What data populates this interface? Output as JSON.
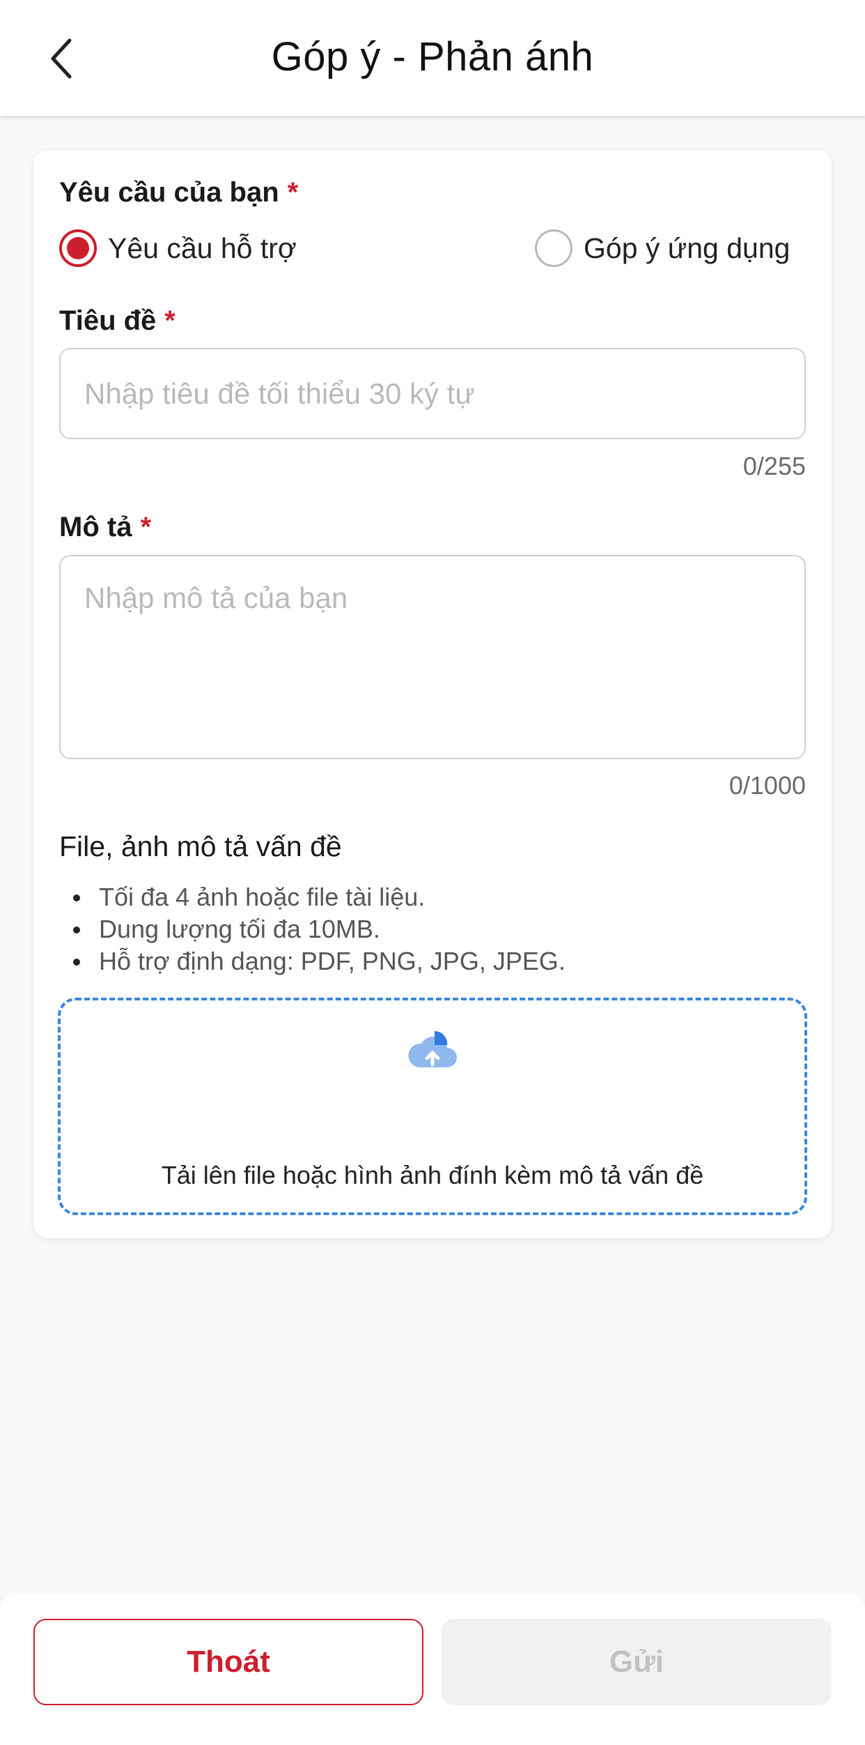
{
  "header": {
    "title": "Góp ý - Phản ánh"
  },
  "form": {
    "request_type": {
      "label": "Yêu cầu của bạn",
      "required_mark": "*",
      "options": [
        {
          "label": "Yêu cầu hỗ trợ",
          "selected": true
        },
        {
          "label": "Góp ý ứng dụng",
          "selected": false
        }
      ]
    },
    "title_field": {
      "label": "Tiêu đề",
      "required_mark": "*",
      "value": "",
      "placeholder": "Nhập tiêu đề tối thiểu 30 ký tự",
      "counter": "0/255"
    },
    "description_field": {
      "label": "Mô tả",
      "required_mark": "*",
      "value": "",
      "placeholder": "Nhập mô tả của bạn",
      "counter": "0/1000"
    },
    "attachments": {
      "label": "File, ảnh mô tả vấn đề",
      "rules": [
        "Tối đa 4 ảnh hoặc file tài liệu.",
        "Dung lượng tối đa 10MB.",
        "Hỗ trợ định dạng: PDF, PNG, JPG, JPEG."
      ],
      "upload_text": "Tải lên file hoặc hình ảnh đính kèm mô tả vấn đề",
      "upload_icon": "cloud-upload-icon"
    }
  },
  "footer": {
    "exit_label": "Thoát",
    "send_label": "Gửi",
    "send_enabled": false
  },
  "colors": {
    "accent": "#cc1f2e",
    "upload_border": "#3b86e0",
    "disabled_bg": "#f1f1f1",
    "disabled_text": "#c2c2c2"
  }
}
